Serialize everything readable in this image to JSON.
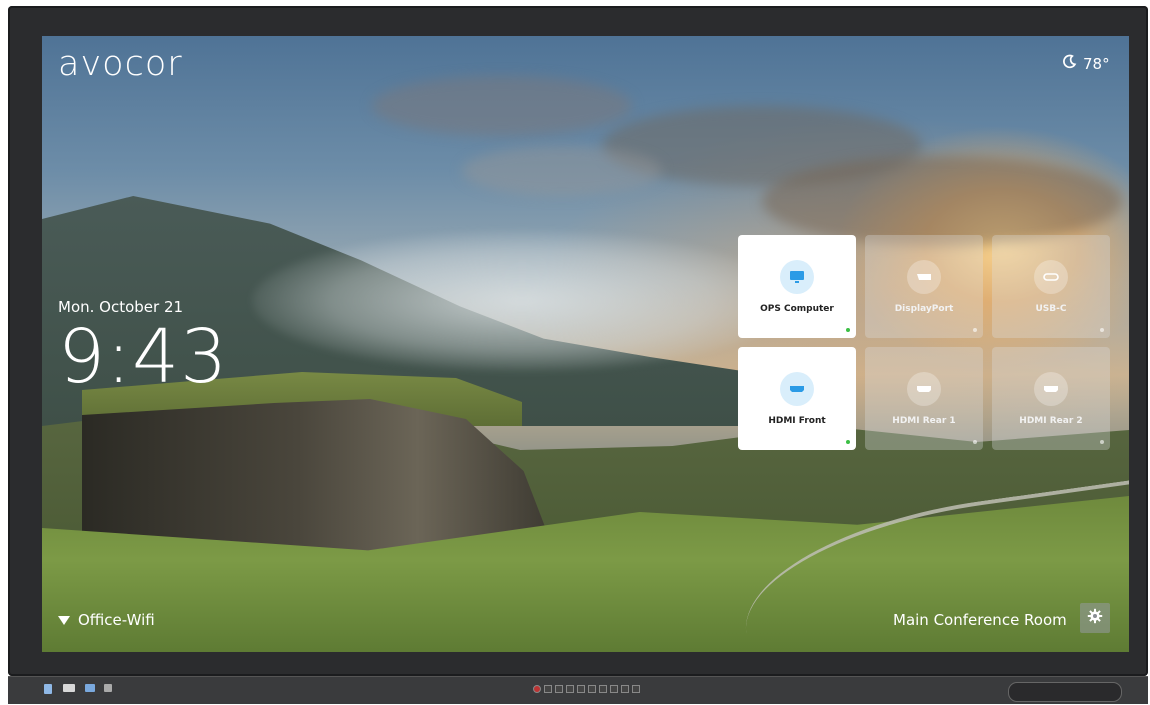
{
  "brand": {
    "logo_text": "avocor"
  },
  "weather": {
    "icon": "moon-icon",
    "temperature": "78°"
  },
  "clock": {
    "date": "Mon. October 21",
    "time": "9:43"
  },
  "sources": [
    {
      "label": "OPS Computer",
      "icon": "monitor-icon",
      "state": "active"
    },
    {
      "label": "DisplayPort",
      "icon": "displayport-icon",
      "state": "inactive"
    },
    {
      "label": "USB-C",
      "icon": "usb-c-icon",
      "state": "inactive"
    },
    {
      "label": "HDMI Front",
      "icon": "hdmi-icon",
      "state": "active"
    },
    {
      "label": "HDMI Rear 1",
      "icon": "hdmi-icon",
      "state": "inactive"
    },
    {
      "label": "HDMI Rear 2",
      "icon": "hdmi-icon",
      "state": "inactive"
    }
  ],
  "network": {
    "icon": "wifi-icon",
    "name": "Office-Wifi"
  },
  "room": {
    "name": "Main Conference Room"
  },
  "settings": {
    "icon": "gear-icon"
  },
  "colors": {
    "accent": "#2b9be6",
    "active_dot": "#3cbf45",
    "tile_active_bg": "#ffffff"
  }
}
